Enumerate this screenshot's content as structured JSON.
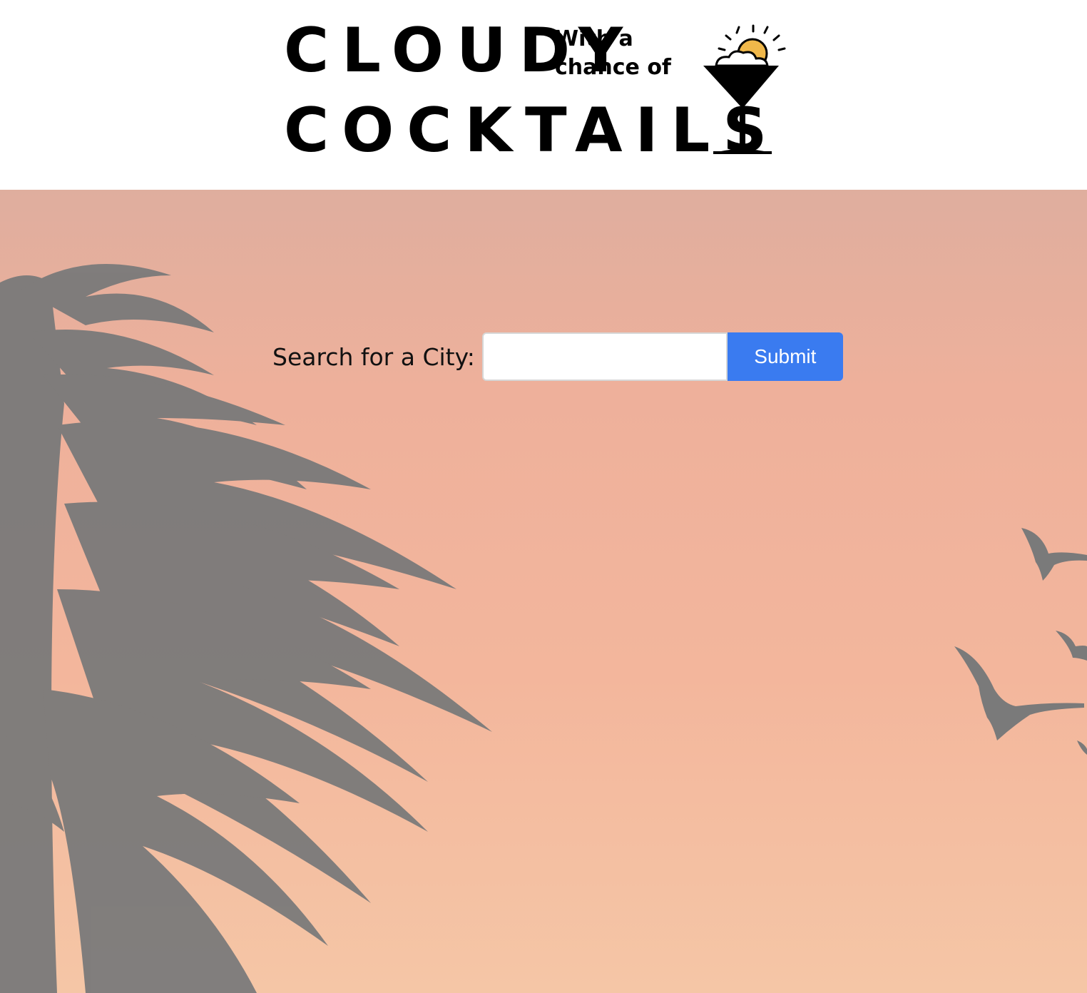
{
  "logo": {
    "line1": "CLOUDY",
    "small_line1": "With a",
    "small_line2": "chance of",
    "line2": "COCKTAILS",
    "icon": "cocktail-glass-sun-cloud-icon"
  },
  "search": {
    "label": "Search for a City:",
    "input_value": "",
    "placeholder": "",
    "submit_label": "Submit"
  },
  "colors": {
    "submit_button": "#3a7bf0",
    "hero_top": "#dfae9e",
    "hero_bottom": "#f5c6a6",
    "silhouette": "#7a7a7a",
    "sun": "#f0b84a"
  }
}
